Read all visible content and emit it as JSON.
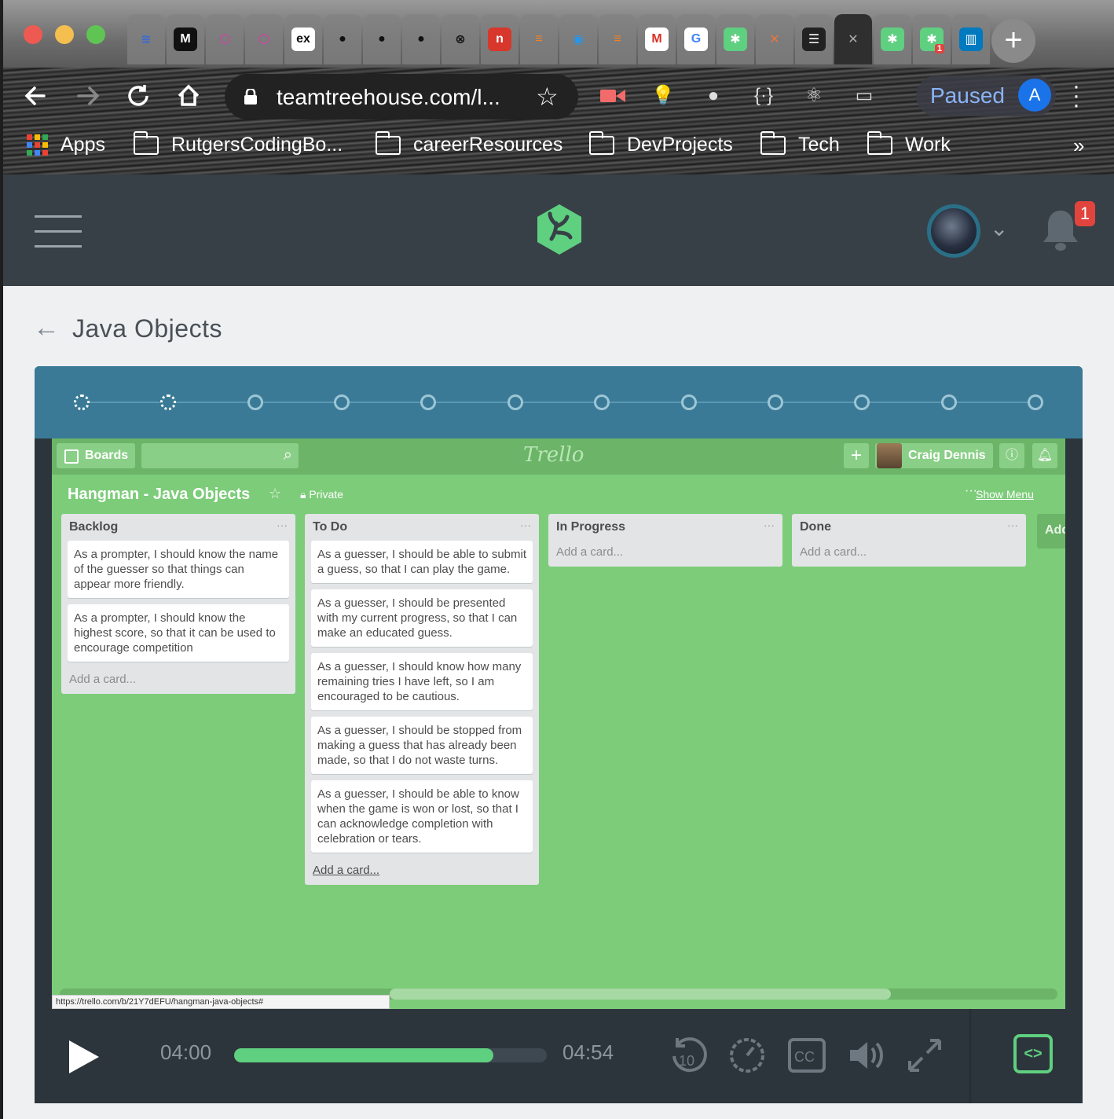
{
  "browser": {
    "tabs": [
      {
        "icon": "wave-icon",
        "glyph": "≋",
        "color": "#3a6bd6",
        "bg": "transparent"
      },
      {
        "icon": "medium-icon",
        "glyph": "M",
        "color": "#fff",
        "bg": "#111"
      },
      {
        "icon": "graphql-icon",
        "glyph": "⬡",
        "color": "#e535ab",
        "bg": "transparent"
      },
      {
        "icon": "graphql-icon-2",
        "glyph": "⬡",
        "color": "#e535ab",
        "bg": "transparent"
      },
      {
        "icon": "ex-icon",
        "glyph": "ex",
        "color": "#111",
        "bg": "#fff"
      },
      {
        "icon": "github-icon",
        "glyph": "●",
        "color": "#111",
        "bg": "transparent"
      },
      {
        "icon": "github-icon-2",
        "glyph": "●",
        "color": "#111",
        "bg": "transparent"
      },
      {
        "icon": "github-icon-3",
        "glyph": "●",
        "color": "#111",
        "bg": "transparent"
      },
      {
        "icon": "x-circle-icon",
        "glyph": "⊗",
        "color": "#111",
        "bg": "transparent"
      },
      {
        "icon": "n-icon",
        "glyph": "n",
        "color": "#fff",
        "bg": "#d8372c"
      },
      {
        "icon": "stackoverflow-icon",
        "glyph": "≡",
        "color": "#f48024",
        "bg": "transparent"
      },
      {
        "icon": "docker-icon",
        "glyph": "◉",
        "color": "#2496ed",
        "bg": "transparent"
      },
      {
        "icon": "stackoverflow-icon-2",
        "glyph": "≡",
        "color": "#f48024",
        "bg": "transparent"
      },
      {
        "icon": "gmail-icon",
        "glyph": "M",
        "color": "#d93025",
        "bg": "#fff"
      },
      {
        "icon": "google-icon",
        "glyph": "G",
        "color": "#4285f4",
        "bg": "#fff"
      },
      {
        "icon": "treehouse-icon",
        "glyph": "✱",
        "color": "#fff",
        "bg": "#5fcf80"
      },
      {
        "icon": "tools-icon",
        "glyph": "✕",
        "color": "#e8773a",
        "bg": "transparent"
      },
      {
        "icon": "stack-icon",
        "glyph": "☰",
        "color": "#fff",
        "bg": "#222"
      },
      {
        "icon": "close-icon",
        "glyph": "✕",
        "color": "#aaa",
        "bg": "transparent",
        "active": true
      },
      {
        "icon": "treehouse-icon-2",
        "glyph": "✱",
        "color": "#fff",
        "bg": "#5fcf80"
      },
      {
        "icon": "treehouse-icon-3",
        "glyph": "✱",
        "color": "#fff",
        "bg": "#5fcf80",
        "badge": "1"
      },
      {
        "icon": "trello-icon",
        "glyph": "▥",
        "color": "#fff",
        "bg": "#0079bf"
      }
    ],
    "url": "teamtreehouse.com/l...",
    "profile_status": "Paused",
    "profile_initial": "A",
    "bookmarks": [
      "Apps",
      "RutgersCodingBo...",
      "careerResources",
      "DevProjects",
      "Tech",
      "Work"
    ],
    "bookmarks_more": "»"
  },
  "header": {
    "notification_count": "1"
  },
  "page": {
    "title": "Java Objects"
  },
  "stepper": {
    "steps_total": 12,
    "steps_completed": 2
  },
  "trello": {
    "boards_label": "Boards",
    "logo_text": "Trello",
    "user_name": "Craig Dennis",
    "board_title": "Hangman - Java Objects",
    "visibility": "Private",
    "show_menu": "Show Menu",
    "lists": [
      {
        "title": "Backlog",
        "cards": [
          "As a prompter, I should know the name of the guesser so that things can appear more friendly.",
          "As a prompter, I should know the highest score, so that it can be used to encourage competition"
        ],
        "add_card": "Add a card..."
      },
      {
        "title": "To Do",
        "cards": [
          "As a guesser, I should be able to submit a guess, so that I can play the game.",
          "As a guesser, I should be presented with my current progress, so that I can make an educated guess.",
          "As a guesser, I should know how many remaining tries I have left, so I am encouraged to be cautious.",
          "As a guesser, I should be stopped from making a guess that has already been made, so that I do not waste turns.",
          "As a guesser, I should be able to know when the game is won or lost, so that I can acknowledge completion with celebration or tears."
        ],
        "add_card": "Add a card..."
      },
      {
        "title": "In Progress",
        "cards": [],
        "add_card": "Add a card..."
      },
      {
        "title": "Done",
        "cards": [],
        "add_card": "Add a card..."
      }
    ],
    "add_list_partial": "Add",
    "status_url": "https://trello.com/b/21Y7dEFU/hangman-java-objects#"
  },
  "player": {
    "current_time": "04:00",
    "total_time": "04:54",
    "progress_fraction": 0.83,
    "accent_color": "#5fcf80",
    "rewind_label": "10",
    "cc_label": "CC"
  }
}
